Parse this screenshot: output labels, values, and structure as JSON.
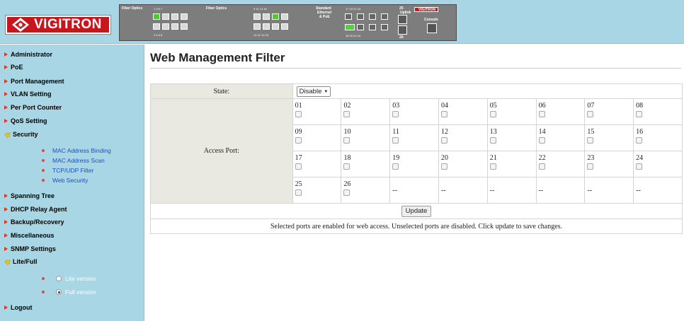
{
  "header": {
    "brand": "VIGITRON",
    "panel": {
      "fiber_label_1": "Fiber Optics",
      "fiber_label_2": "Fiber Optics",
      "std_label_1": "Standard",
      "std_label_2": "Ethernet",
      "std_label_3": "& PoE",
      "uplink_label": "Uplink",
      "console_label": "Console",
      "mini_brand": "VIGITRON",
      "top_numbers_a": "1   3   5   7",
      "bottom_numbers_a": "2   4   6   8",
      "top_numbers_b": "9   11   13   15",
      "bottom_numbers_b": "10   12   14   16",
      "top_numbers_c": "17   19   21   23",
      "bottom_numbers_c": "18   20   22   24",
      "num_25": "25",
      "num_26": "26",
      "green_letter": "F"
    }
  },
  "sidebar": {
    "items": [
      {
        "label": "Administrator"
      },
      {
        "label": "PoE"
      },
      {
        "label": "Port Management"
      },
      {
        "label": "VLAN Setting"
      },
      {
        "label": "Per Port Counter"
      },
      {
        "label": "QoS Setting"
      },
      {
        "label": "Security"
      },
      {
        "label": "Spanning Tree"
      },
      {
        "label": "DHCP Relay Agent"
      },
      {
        "label": "Backup/Recovery"
      },
      {
        "label": "Miscellaneous"
      },
      {
        "label": "SNMP Settings"
      },
      {
        "label": "Lite/Full"
      },
      {
        "label": "Logout"
      }
    ],
    "security_sub": [
      {
        "label": "MAC Address Binding"
      },
      {
        "label": "MAC Address Scan"
      },
      {
        "label": "TCP/UDP Filter"
      },
      {
        "label": "Web Security"
      }
    ],
    "version": {
      "lite_label": "Lite version",
      "full_label": "Full version",
      "selected": "Full version"
    }
  },
  "main": {
    "title": "Web Management Filter",
    "state_label": "State:",
    "state_value": "Disable",
    "access_port_label": "Access Port:",
    "ports": [
      "01",
      "02",
      "03",
      "04",
      "05",
      "06",
      "07",
      "08",
      "09",
      "10",
      "11",
      "12",
      "13",
      "14",
      "15",
      "16",
      "17",
      "18",
      "19",
      "20",
      "21",
      "22",
      "23",
      "24",
      "25",
      "26"
    ],
    "empty_cell": "--",
    "update_label": "Update",
    "note": "Selected ports are enabled for web access. Unselected ports are disabled. Click update to save changes."
  },
  "colors": {
    "sidebar_bg": "#a9d6e4",
    "brand_red": "#c9161d",
    "link_blue": "#1a4fc8",
    "label_bg": "#e9e9e1"
  }
}
